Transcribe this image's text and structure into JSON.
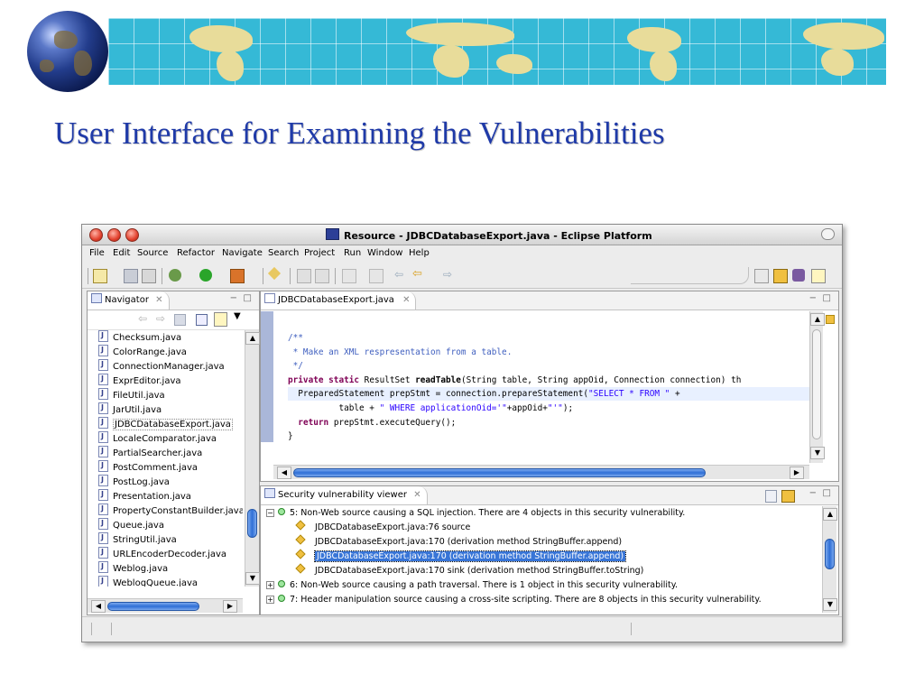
{
  "slide": {
    "title": "User Interface for Examining the Vulnerabilities"
  },
  "window": {
    "title": "Resource - JDBCDatabaseExport.java - Eclipse Platform"
  },
  "menu": [
    "File",
    "Edit",
    "Source",
    "Refactor",
    "Navigate",
    "Search",
    "Project",
    "Run",
    "Window",
    "Help"
  ],
  "navigator": {
    "tab_label": "Navigator",
    "files": [
      "Checksum.java",
      "ColorRange.java",
      "ConnectionManager.java",
      "ExprEditor.java",
      "FileUtil.java",
      "JarUtil.java",
      "JDBCDatabaseExport.java",
      "LocaleComparator.java",
      "PartialSearcher.java",
      "PostComment.java",
      "PostLog.java",
      "Presentation.java",
      "PropertyConstantBuilder.java",
      "Queue.java",
      "StringUtil.java",
      "URLEncoderDecoder.java",
      "Weblog.java",
      "WeblogQueue.java"
    ]
  },
  "editor": {
    "tab_label": "JDBCDatabaseExport.java",
    "lines": {
      "l1": "/**",
      "l2": " * Make an XML respresentation from a table.",
      "l3": " */",
      "l4_kw": "private static",
      "l4_a": " ResultSet ",
      "l4_b": "readTable",
      "l4_c": "(String table, String appOid, Connection connection) th",
      "l5_a": "  PreparedStatement prepStmt = connection.prepareStatement(",
      "l5_str": "\"SELECT * FROM \"",
      "l5_b": " +",
      "l6_a": "          table + ",
      "l6_str1": "\" WHERE applicationOid='\"",
      "l6_b": "+appOid+",
      "l6_str2": "\"'\"",
      "l6_c": ");",
      "l7_kw": "return",
      "l7_a": " prepStmt.executeQuery();",
      "l8": "}"
    }
  },
  "viewer": {
    "tab_label": "Security vulnerability viewer",
    "rows": {
      "r1": "5: Non-Web source causing a SQL injection. There are  4  objects in this security vulnerability.",
      "r2": "JDBCDatabaseExport.java:76 source",
      "r3": "JDBCDatabaseExport.java:170 (derivation method StringBuffer.append)",
      "r4": "JDBCDatabaseExport.java:170 (derivation method StringBuffer.append)",
      "r5": "JDBCDatabaseExport.java:170 sink (derivation method StringBuffer.toString)",
      "r6": "6: Non-Web source causing a path traversal. There is 1 object in this security vulnerability.",
      "r7": "7: Header manipulation source causing a cross-site scripting. There are  8  objects in this security vulnerability."
    },
    "expanders": {
      "open": "−",
      "closed": "+"
    }
  },
  "icons": {
    "minimize": "−",
    "maximize": "□",
    "close_tab": "✕",
    "arrow_up": "▲",
    "arrow_down": "▼",
    "arrow_left": "◀",
    "arrow_right": "▶"
  }
}
